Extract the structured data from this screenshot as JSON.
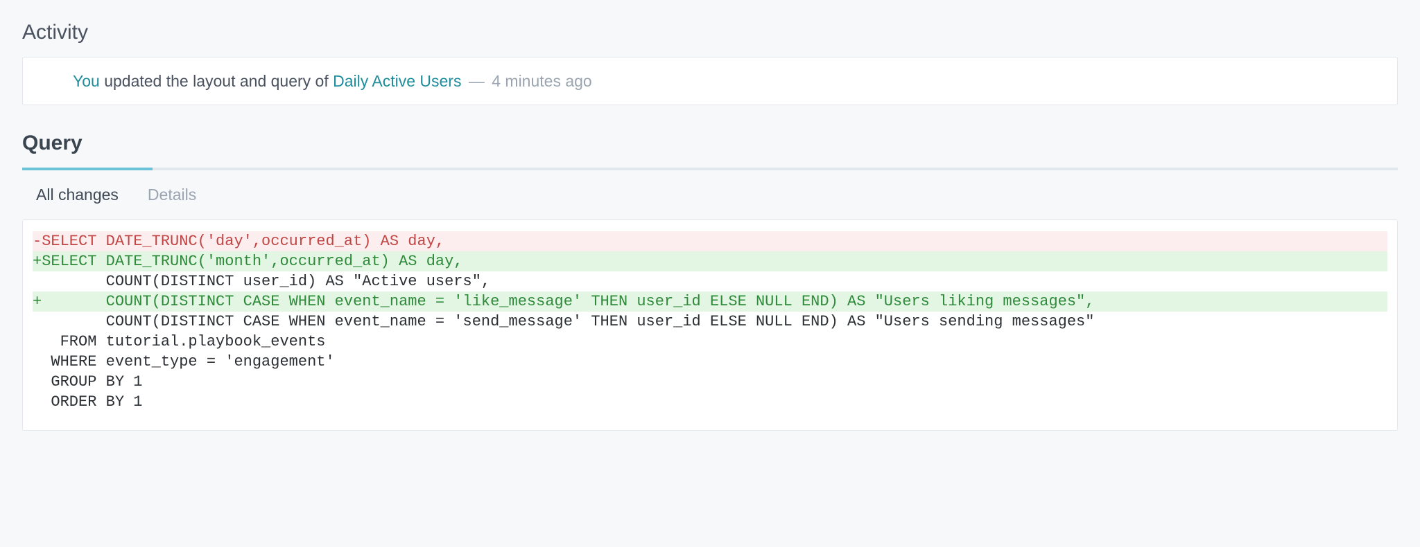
{
  "headings": {
    "activity": "Activity",
    "query": "Query"
  },
  "activity": {
    "actor": "You",
    "action_prefix": " updated the layout and query of ",
    "report_name": "Daily Active Users",
    "separator": " — ",
    "time_ago": "4 minutes ago"
  },
  "tabs": {
    "all_changes": "All changes",
    "details": "Details",
    "active": "all_changes"
  },
  "diff": {
    "lines": [
      {
        "type": "del",
        "text": "-SELECT DATE_TRUNC('day',occurred_at) AS day,"
      },
      {
        "type": "add",
        "text": "+SELECT DATE_TRUNC('month',occurred_at) AS day,"
      },
      {
        "type": "ctx",
        "text": "        COUNT(DISTINCT user_id) AS \"Active users\","
      },
      {
        "type": "add",
        "text": "+       COUNT(DISTINCT CASE WHEN event_name = 'like_message' THEN user_id ELSE NULL END) AS \"Users liking messages\","
      },
      {
        "type": "ctx",
        "text": "        COUNT(DISTINCT CASE WHEN event_name = 'send_message' THEN user_id ELSE NULL END) AS \"Users sending messages\""
      },
      {
        "type": "ctx",
        "text": "   FROM tutorial.playbook_events"
      },
      {
        "type": "ctx",
        "text": "  WHERE event_type = 'engagement'"
      },
      {
        "type": "ctx",
        "text": "  GROUP BY 1"
      },
      {
        "type": "ctx",
        "text": "  ORDER BY 1"
      }
    ]
  },
  "colors": {
    "bg": "#f6f8fa",
    "link": "#1f8d9c",
    "progress_fill": "#6ac3d6",
    "diff_del_bg": "#fceeee",
    "diff_del_fg": "#c24545",
    "diff_add_bg": "#e3f6e3",
    "diff_add_fg": "#2e8a3a"
  }
}
